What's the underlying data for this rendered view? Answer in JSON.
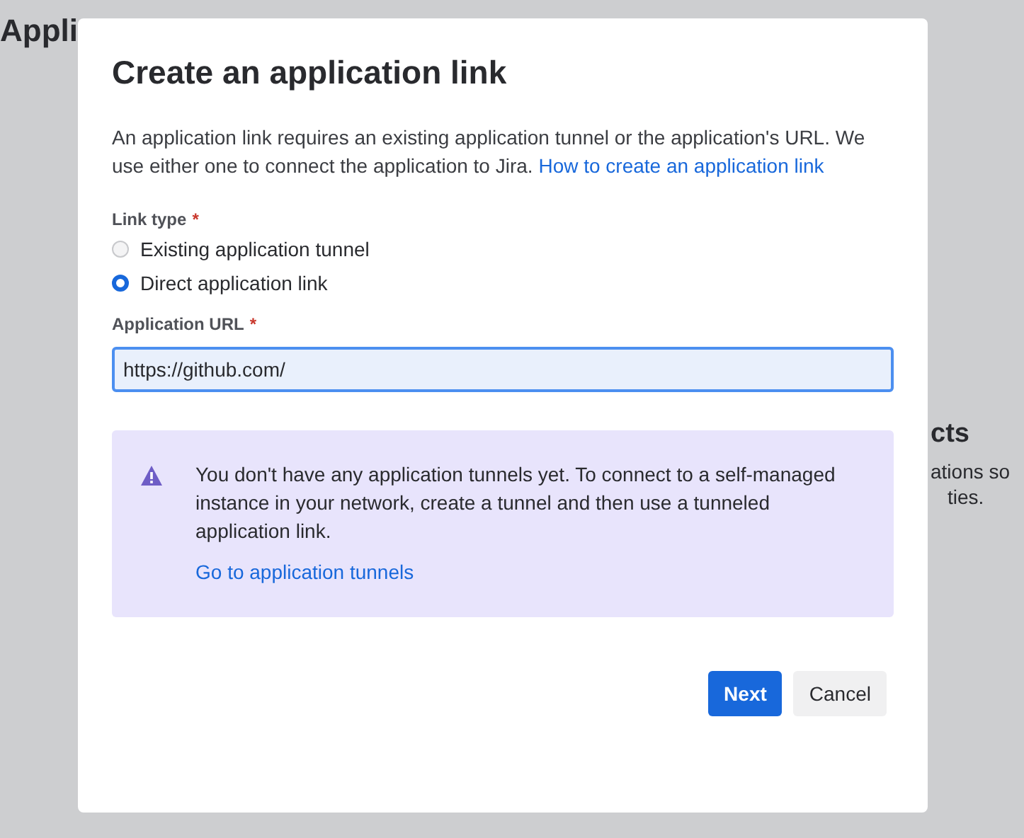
{
  "background": {
    "page_title": "Appli",
    "side_heading": "cts",
    "side_text": [
      "ations so",
      "ties."
    ]
  },
  "dialog": {
    "title": "Create an application link",
    "description": "An application link requires an existing application tunnel or the application's URL. We use either one to connect the application to Jira.",
    "description_link": "How to create an application link",
    "link_type": {
      "label": "Link type",
      "required_mark": "*",
      "options": [
        {
          "label": "Existing application tunnel",
          "selected": false
        },
        {
          "label": "Direct application link",
          "selected": true
        }
      ]
    },
    "url_field": {
      "label": "Application URL",
      "required_mark": "*",
      "value": "https://github.com/",
      "focused": true
    },
    "notice": {
      "text": "You don't have any application tunnels yet. To connect to a self-managed instance in your network, create a tunnel and then use a tunneled application link.",
      "link": "Go to application tunnels"
    },
    "buttons": [
      {
        "label": "Next",
        "kind": "primary"
      },
      {
        "label": "Cancel",
        "kind": "secondary"
      }
    ]
  }
}
